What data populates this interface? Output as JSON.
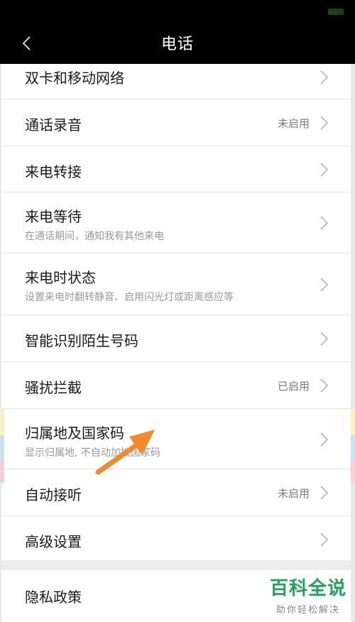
{
  "header": {
    "title": "电话",
    "back_icon": "chevron-left-icon"
  },
  "settings": [
    {
      "title": "双卡和移动网络"
    },
    {
      "title": "通话录音",
      "status": "未启用"
    },
    {
      "title": "来电转接"
    },
    {
      "title": "来电等待",
      "subtitle": "在通话期间，通知我有其他来电"
    },
    {
      "title": "来电时状态",
      "subtitle": "设置来电时翻转静音、启用闪光灯或距离感应等"
    },
    {
      "title": "智能识别陌生号码"
    },
    {
      "title": "骚扰拦截",
      "status": "已启用"
    },
    {
      "title": "归属地及国家码",
      "subtitle": "显示归属地, 不自动加拨国家码"
    },
    {
      "title": "自动接听",
      "status": "未启用"
    },
    {
      "title": "高级设置"
    }
  ],
  "privacy": {
    "title": "隐私政策"
  },
  "watermark": {
    "main": "百科全说",
    "sub": "助你轻松解决"
  },
  "colors": {
    "header_bg": "#000000",
    "arrow": "#f08a2c",
    "watermark_green": "#28a05a",
    "chevron": "#b5b5b5"
  }
}
